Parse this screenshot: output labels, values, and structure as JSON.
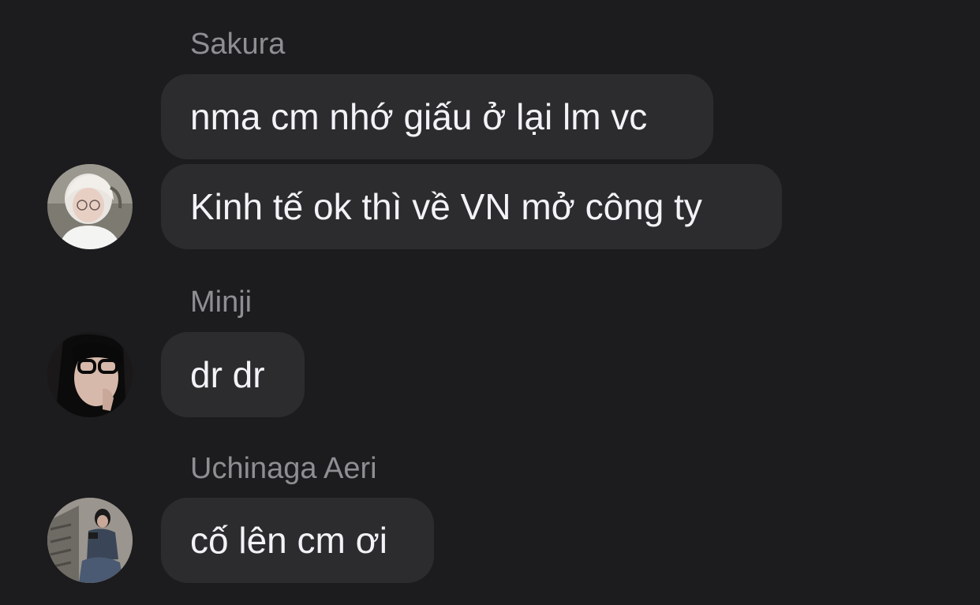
{
  "messages": [
    {
      "sender": "Sakura",
      "avatar_icon": "user-avatar-icon",
      "bubbles": [
        "nma cm nhớ giấu ở lại lm vc",
        "Kinh tế ok thì về VN mở công ty"
      ]
    },
    {
      "sender": "Minji",
      "avatar_icon": "user-avatar-icon",
      "bubbles": [
        "dr dr"
      ]
    },
    {
      "sender": "Uchinaga Aeri",
      "avatar_icon": "user-avatar-icon",
      "bubbles": [
        "cố lên cm ơi"
      ]
    }
  ],
  "colors": {
    "background": "#1c1c1e",
    "bubble": "#2c2c2e",
    "sender_name": "#8e8e93",
    "text": "#f2f2f7"
  }
}
